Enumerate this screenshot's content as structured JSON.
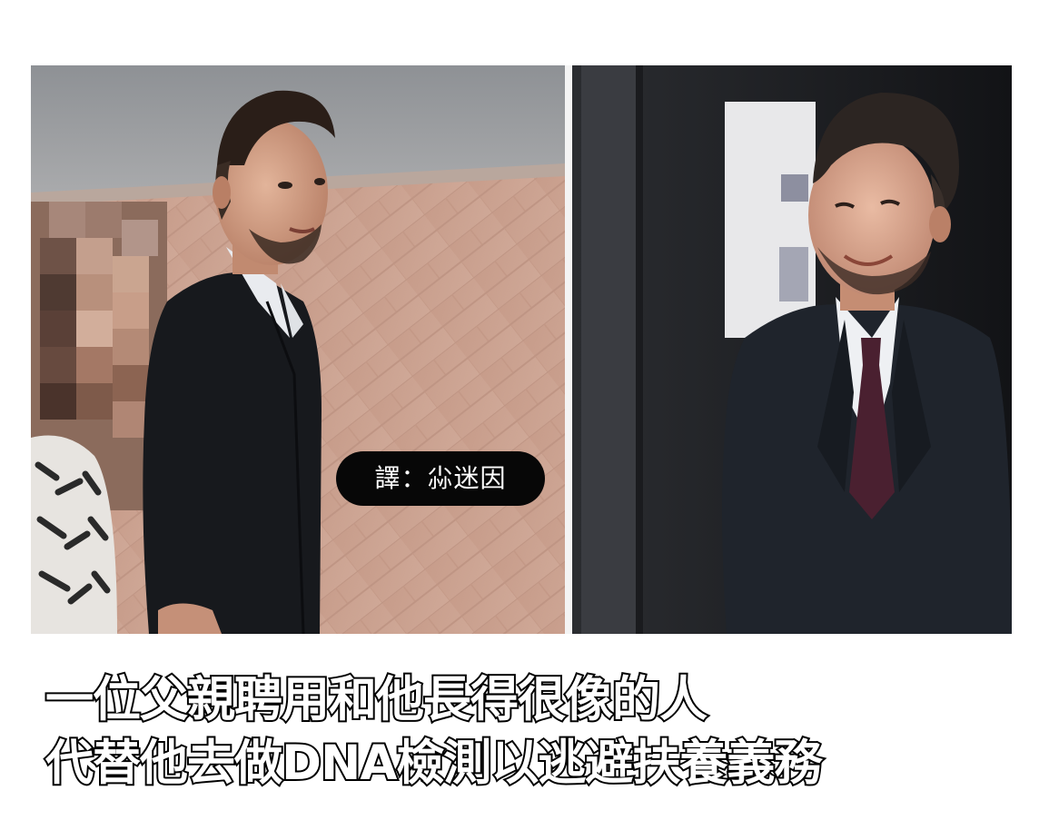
{
  "image": {
    "watermark": "譯：尛迷因",
    "caption_lines": [
      "一位父親聘用和他長得很像的人",
      "代替他去做DNA檢測以逃避扶養義務"
    ],
    "colors": {
      "caption_fill": "#ffffff",
      "caption_stroke": "#000000",
      "watermark_bg": "#070707",
      "suit": "#17191d",
      "wall": "#c9a08e"
    }
  }
}
